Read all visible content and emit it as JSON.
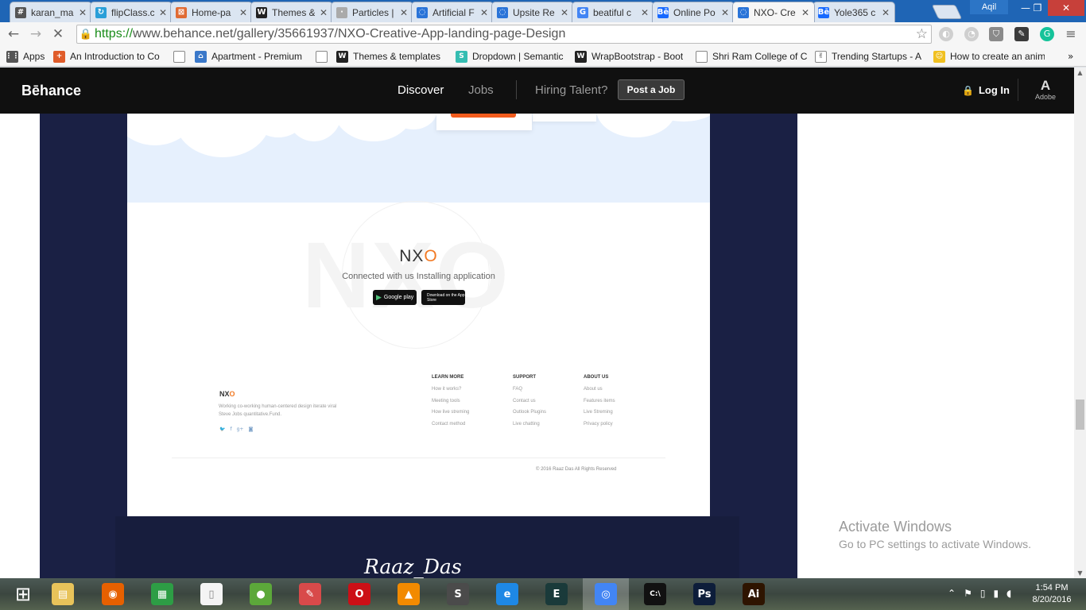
{
  "browser": {
    "tabs": [
      {
        "label": "karan_ma",
        "icon": "slack-hash-icon",
        "color": "#555555",
        "glyph": "#"
      },
      {
        "label": "flipClass.c",
        "icon": "flipclass-icon",
        "color": "#2a9fd8",
        "glyph": "↻"
      },
      {
        "label": "Home-pa",
        "icon": "xampp-icon",
        "color": "#e06b34",
        "glyph": "⊠"
      },
      {
        "label": "Themes &",
        "icon": "wrapbootstrap-icon",
        "color": "#222222",
        "glyph": "W"
      },
      {
        "label": "Particles |",
        "icon": "particles-icon",
        "color": "#aaaaaa",
        "glyph": "·"
      },
      {
        "label": "Artificial F",
        "icon": "loading-icon",
        "color": "#2a74d8",
        "glyph": "◌"
      },
      {
        "label": "Upsite Re",
        "icon": "loading-icon",
        "color": "#2a74d8",
        "glyph": "◌"
      },
      {
        "label": "beatiful c",
        "icon": "google-icon",
        "color": "#4285f4",
        "glyph": "G"
      },
      {
        "label": "Online Po",
        "icon": "behance-icon",
        "color": "#1769ff",
        "glyph": "Bē"
      },
      {
        "label": "NXO- Cre",
        "icon": "loading-icon",
        "color": "#2a74d8",
        "glyph": "◌",
        "active": true
      },
      {
        "label": "Yole365 c",
        "icon": "behance-icon",
        "color": "#1769ff",
        "glyph": "Bē"
      }
    ],
    "profile_name": "Aqil",
    "url_scheme": "https://",
    "url_rest": "www.behance.net/gallery/35661937/NXO-Creative-App-landing-page-Design",
    "bookmarks": [
      {
        "label": "Apps",
        "icon": "apps-grid-icon",
        "color": "#555555",
        "glyph": "⋮⋮"
      },
      {
        "label": "An Introduction to Co",
        "icon": "plus-icon",
        "color": "#e05c2a",
        "glyph": "+"
      },
      {
        "label": "",
        "icon": "page-icon",
        "color": "#ffffff",
        "glyph": ""
      },
      {
        "label": "Apartment - Premium",
        "icon": "home-icon",
        "color": "#3a78c9",
        "glyph": "⌂"
      },
      {
        "label": "",
        "icon": "page-icon",
        "color": "#ffffff",
        "glyph": ""
      },
      {
        "label": "Themes & templates",
        "icon": "wrapbootstrap-icon",
        "color": "#222222",
        "glyph": "W"
      },
      {
        "label": "Dropdown | Semantic",
        "icon": "semantic-icon",
        "color": "#35bdb2",
        "glyph": "S"
      },
      {
        "label": "WrapBootstrap - Boot",
        "icon": "wrapbootstrap-icon",
        "color": "#222222",
        "glyph": "W"
      },
      {
        "label": "Shri Ram College of C",
        "icon": "page-icon",
        "color": "#ffffff",
        "glyph": ""
      },
      {
        "label": "Trending Startups - A",
        "icon": "angellist-icon",
        "color": "#ffffff",
        "glyph": "✌"
      },
      {
        "label": "How to create an anim",
        "icon": "emoji-icon",
        "color": "#f0c020",
        "glyph": "☺"
      }
    ]
  },
  "behance": {
    "logo": "Bēhance",
    "nav": {
      "discover": "Discover",
      "jobs": "Jobs",
      "hiring": "Hiring Talent?",
      "post_job": "Post a Job"
    },
    "login": "Log In",
    "adobe_label": "Adobe",
    "adobe_mark": "A"
  },
  "design": {
    "bg_word": "NXO",
    "title_main": "NX",
    "title_accent": "O",
    "subtitle": "Connected with us Installing application",
    "store_buttons": [
      {
        "label": "Google play",
        "icon": "google-play-icon",
        "glyph": "▶"
      },
      {
        "label": "Download on the App Store",
        "icon": "apple-icon",
        "glyph": ""
      }
    ],
    "footer": {
      "logo_main": "NX",
      "logo_accent": "O",
      "description": "Working co-working human-centered design iterate viral Steve Jobs quantitative.Fund.",
      "social": [
        {
          "icon": "twitter-icon",
          "glyph": "🐦"
        },
        {
          "icon": "facebook-icon",
          "glyph": "f"
        },
        {
          "icon": "google-plus-icon",
          "glyph": "g+"
        },
        {
          "icon": "instagram-icon",
          "glyph": "◙"
        }
      ],
      "columns": [
        {
          "heading": "LEARN MORE",
          "items": [
            "How it works?",
            "Meeting tools",
            "How live streming",
            "Contact method"
          ]
        },
        {
          "heading": "SUPPORT",
          "items": [
            "FAQ",
            "Contact us",
            "Outlook Plugins",
            "Live chatting"
          ]
        },
        {
          "heading": "ABOUT US",
          "items": [
            "About us",
            "Features items",
            "Live Streming",
            "Privacy policy"
          ]
        }
      ],
      "copyright": "© 2016 Raaz Das All Rights Reserved"
    },
    "signature": "Raaz_Das"
  },
  "windows": {
    "activate_title": "Activate Windows",
    "activate_sub": "Go to PC settings to activate Windows.",
    "time": "1:54 PM",
    "date": "8/20/2016",
    "taskbar_apps": [
      {
        "name": "start-button",
        "glyph": "⊞",
        "color": "transparent"
      },
      {
        "name": "file-explorer",
        "glyph": "▤",
        "color": "#e8c35a"
      },
      {
        "name": "firefox",
        "glyph": "◉",
        "color": "#e66000"
      },
      {
        "name": "windows-store",
        "glyph": "▦",
        "color": "#2d9d45"
      },
      {
        "name": "notepad-file",
        "glyph": "▯",
        "color": "#f4f4f4"
      },
      {
        "name": "android-app",
        "glyph": "●",
        "color": "#5ca83a"
      },
      {
        "name": "paint-tool",
        "glyph": "✎",
        "color": "#d84a4a"
      },
      {
        "name": "opera",
        "glyph": "O",
        "color": "#cc0f16"
      },
      {
        "name": "vlc",
        "glyph": "▲",
        "color": "#f28a00"
      },
      {
        "name": "sublime-text",
        "glyph": "S",
        "color": "#4b4b4b"
      },
      {
        "name": "internet-explorer",
        "glyph": "e",
        "color": "#1e88e5"
      },
      {
        "name": "edge-cli",
        "glyph": "E",
        "color": "#1a3a3a"
      },
      {
        "name": "chrome",
        "glyph": "◎",
        "color": "#4285f4",
        "active": true
      },
      {
        "name": "command-prompt",
        "glyph": "C:\\",
        "color": "#111111"
      },
      {
        "name": "photoshop",
        "glyph": "Ps",
        "color": "#0d1d3a"
      },
      {
        "name": "illustrator",
        "glyph": "Ai",
        "color": "#2e1400"
      }
    ]
  }
}
